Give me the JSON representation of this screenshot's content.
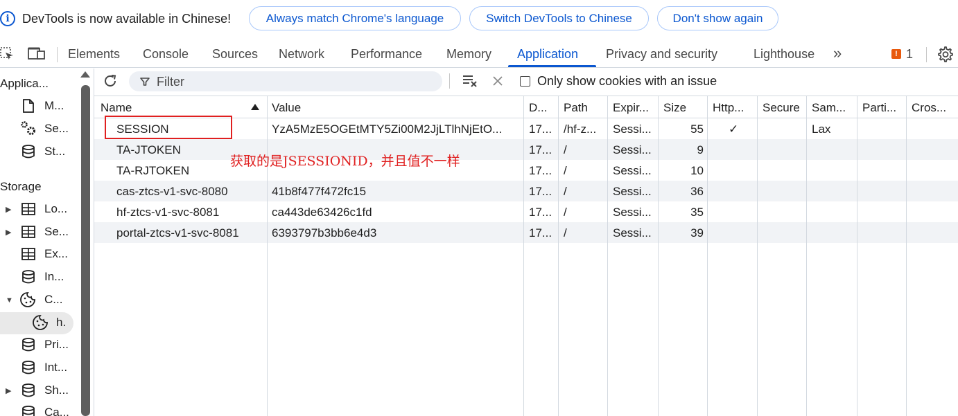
{
  "infobar": {
    "message": "DevTools is now available in Chinese!",
    "btn_match": "Always match Chrome's language",
    "btn_switch": "Switch DevTools to Chinese",
    "btn_dismiss": "Don't show again"
  },
  "tabs": [
    "Elements",
    "Console",
    "Sources",
    "Network",
    "Performance",
    "Memory",
    "Application",
    "Privacy and security",
    "Lighthouse"
  ],
  "active_tab": "Application",
  "more_tabs": "»",
  "issues": {
    "count": "1"
  },
  "sidebar": {
    "app_header": "Applica...",
    "items_app": [
      "M...",
      "Se...",
      "St..."
    ],
    "storage_header": "Storage",
    "items_storage": [
      "Lo...",
      "Se...",
      "Ex...",
      "In...",
      "C...",
      "h.",
      "Pri...",
      "Int...",
      "Sh...",
      "Ca..."
    ]
  },
  "toolbar": {
    "filter_placeholder": "Filter",
    "checkbox_label": "Only show cookies with an issue"
  },
  "table": {
    "columns": [
      "Name",
      "Value",
      "D...",
      "Path",
      "Expir...",
      "Size",
      "Http...",
      "Secure",
      "Sam...",
      "Parti...",
      "Cros..."
    ],
    "rows": [
      {
        "name": "SESSION",
        "value": "YzA5MzE5OGEtMTY5Zi00M2JjLTlhNjEtO...",
        "domain": "17...",
        "path": "/hf-z...",
        "expires": "Sessi...",
        "size": "55",
        "http": "✓",
        "secure": "",
        "same": "Lax"
      },
      {
        "name": "TA-JTOKEN",
        "value": "",
        "domain": "17...",
        "path": "/",
        "expires": "Sessi...",
        "size": "9",
        "http": "",
        "secure": "",
        "same": ""
      },
      {
        "name": "TA-RJTOKEN",
        "value": "",
        "domain": "17...",
        "path": "/",
        "expires": "Sessi...",
        "size": "10",
        "http": "",
        "secure": "",
        "same": ""
      },
      {
        "name": "cas-ztcs-v1-svc-8080",
        "value": "41b8f477f472fc15",
        "domain": "17...",
        "path": "/",
        "expires": "Sessi...",
        "size": "36",
        "http": "",
        "secure": "",
        "same": ""
      },
      {
        "name": "hf-ztcs-v1-svc-8081",
        "value": "ca443de63426c1fd",
        "domain": "17...",
        "path": "/",
        "expires": "Sessi...",
        "size": "35",
        "http": "",
        "secure": "",
        "same": ""
      },
      {
        "name": "portal-ztcs-v1-svc-8081",
        "value": "6393797b3bb6e4d3",
        "domain": "17...",
        "path": "/",
        "expires": "Sessi...",
        "size": "39",
        "http": "",
        "secure": "",
        "same": ""
      }
    ]
  },
  "annotation": {
    "text": "获取的是JSESSIONID，并且值不一样"
  },
  "colors": {
    "accent": "#0b57d0",
    "annotation": "#e02020",
    "issue": "#e8590c"
  }
}
